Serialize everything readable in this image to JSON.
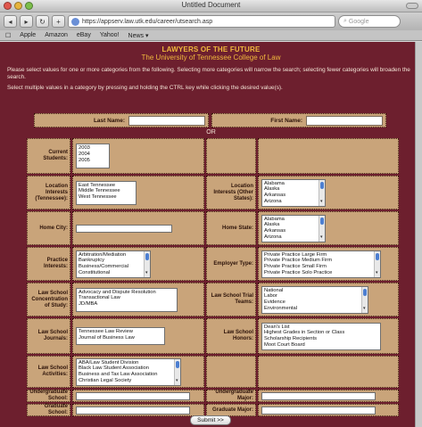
{
  "window": {
    "title": "Untitled Document"
  },
  "toolbar": {
    "back": "◂",
    "forward": "▸",
    "reload": "↻",
    "add": "+",
    "url": "https://appserv.law.utk.edu/career/utsearch.asp",
    "search_placeholder": "Google"
  },
  "bookmarks": [
    "Apple",
    "Amazon",
    "eBay",
    "Yahoo!",
    "News ▾"
  ],
  "header": {
    "line1": "LAWYERS OF THE FUTURE",
    "line2": "The University of Tennessee College of Law"
  },
  "intro": {
    "p1": "Please select values for one or more categories from the following. Selecting more categories will narrow the search; selecting fewer categories will broaden the search.",
    "p2": "Select multiple values in a category by pressing and holding the CTRL key while clicking the desired value(s)."
  },
  "name": {
    "last_label": "Last Name:",
    "first_label": "First Name:",
    "or": "OR"
  },
  "form": {
    "current_students_label": "Current Students:",
    "current_students": [
      "2003",
      "2004",
      "2005"
    ],
    "loc_tn_label": "Location Interests (Tennessee):",
    "loc_tn": [
      "East Tennessee",
      "Middle Tennessee",
      "West Tennessee"
    ],
    "loc_other_label": "Location Interests (Other States):",
    "loc_other": [
      "Alabama",
      "Alaska",
      "Arkansas",
      "Arizona"
    ],
    "home_city_label": "Home City:",
    "home_state_label": "Home State:",
    "home_state": [
      "Alabama",
      "Alaska",
      "Arkansas",
      "Arizona"
    ],
    "practice_label": "Practice Interests:",
    "practice": [
      "Arbitration/Mediation",
      "Bankruptcy",
      "Business/Commercial",
      "Constitutional"
    ],
    "employer_label": "Employer Type:",
    "employer": [
      "Private Practice Large Firm",
      "Private Practice Medium Firm",
      "Private Practice Small Firm",
      "Private Practice Solo Practice"
    ],
    "concentration_label": "Law School Concentration of Study:",
    "concentration": [
      "Advocacy and Dispute Resolution",
      "Transactional Law",
      "JD/MBA"
    ],
    "trial_label": "Law School Trial Teams:",
    "trial": [
      "National",
      "Labor",
      "Evidence",
      "Environmental"
    ],
    "journals_label": "Law School Journals:",
    "journals": [
      "Tennessee Law Review",
      "Journal of Business Law"
    ],
    "honors_label": "Law School Honors:",
    "honors": [
      "Dean's List",
      "Highest Grades in Section or Class",
      "Scholarship Recipients",
      "Moot Court Board"
    ],
    "activities_label": "Law School Activities:",
    "activities": [
      "ABA/Law Student Division",
      "Black Law Student Association",
      "Business and Tax Law Association",
      "Christian Legal Society"
    ],
    "undergrad_school_label": "Undergraduate School:",
    "undergrad_major_label": "Undergraduate Major:",
    "grad_school_label": "Graduate School:",
    "grad_major_label": "Graduate Major:"
  },
  "submit_label": "Submit >>"
}
